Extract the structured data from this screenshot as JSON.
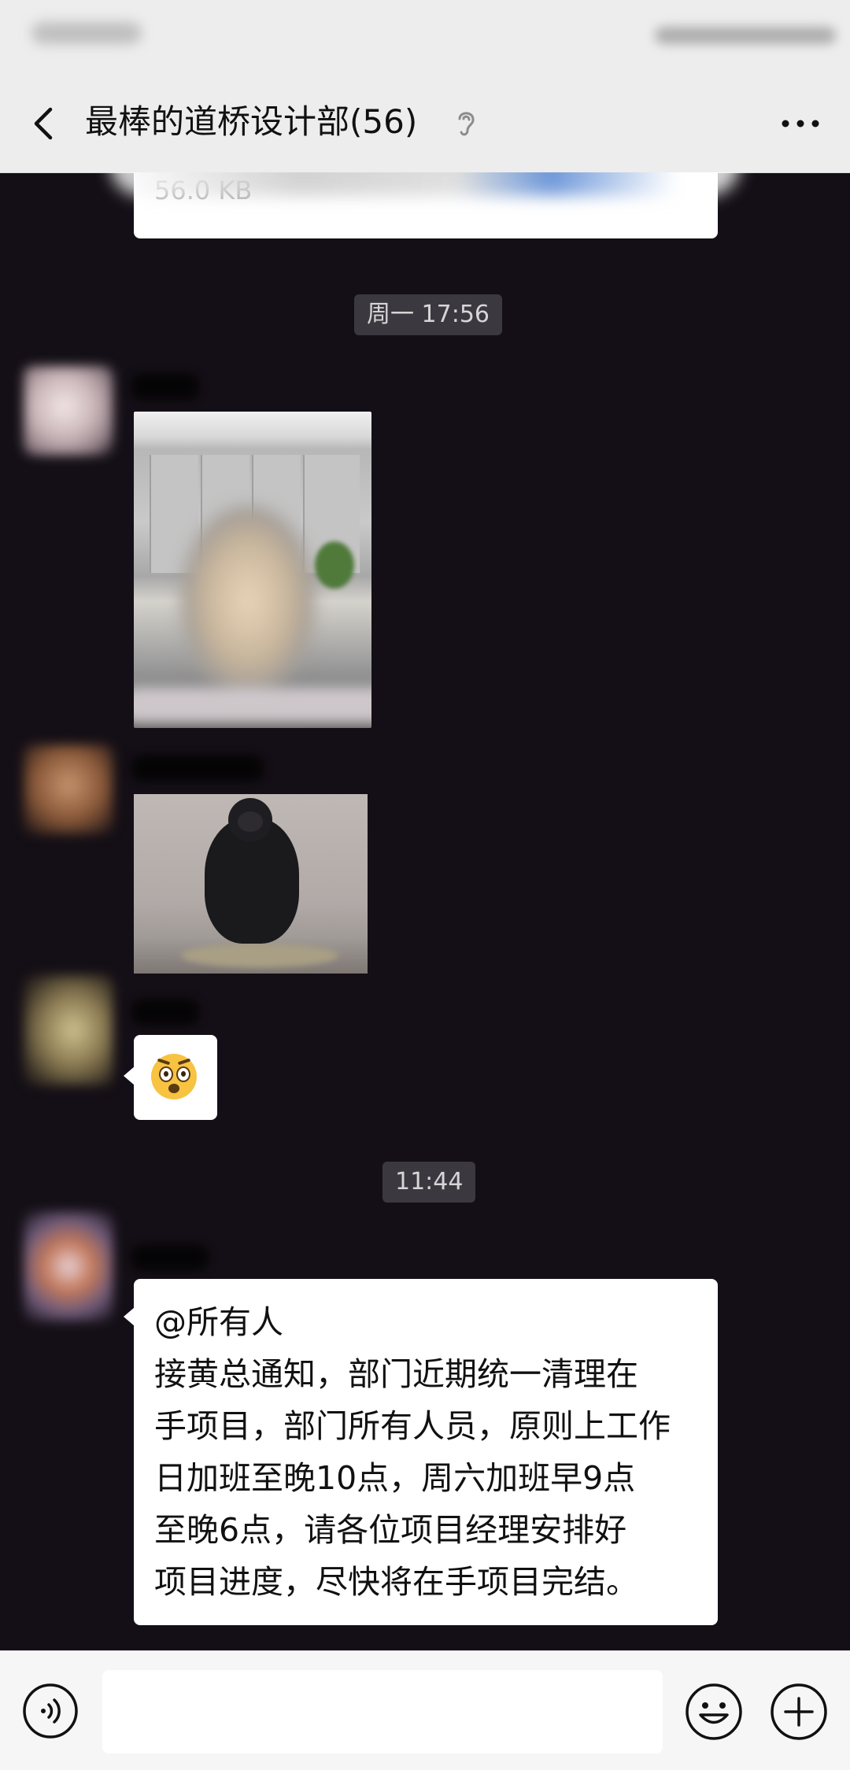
{
  "header": {
    "title": "最棒的道桥设计部(56)"
  },
  "chat": {
    "file_message": {
      "size": "56.0 KB"
    },
    "timestamps": [
      "周一 17:56",
      "11:44"
    ],
    "announcement": {
      "lines": [
        "@所有人",
        "接黄总通知，部门近期统一清理在",
        "手项目，部门所有人员，原则上工作",
        "日加班至晚10点，周六加班早9点",
        "至晚6点，请各位项目经理安排好",
        "项目进度，尽快将在手项目完结。"
      ]
    }
  },
  "icons": {
    "back": "chevron-left-icon",
    "ear": "ear-icon",
    "more": "more-icon",
    "voice": "voice-icon",
    "emoji": "smiley-icon",
    "plus": "plus-icon",
    "sticker": "shocked-face-emoji"
  },
  "colors": {
    "chat_background": "#140f16",
    "bubble": "#ffffff",
    "bar": "#ededed",
    "timestamp_bg": "#3b3840"
  }
}
